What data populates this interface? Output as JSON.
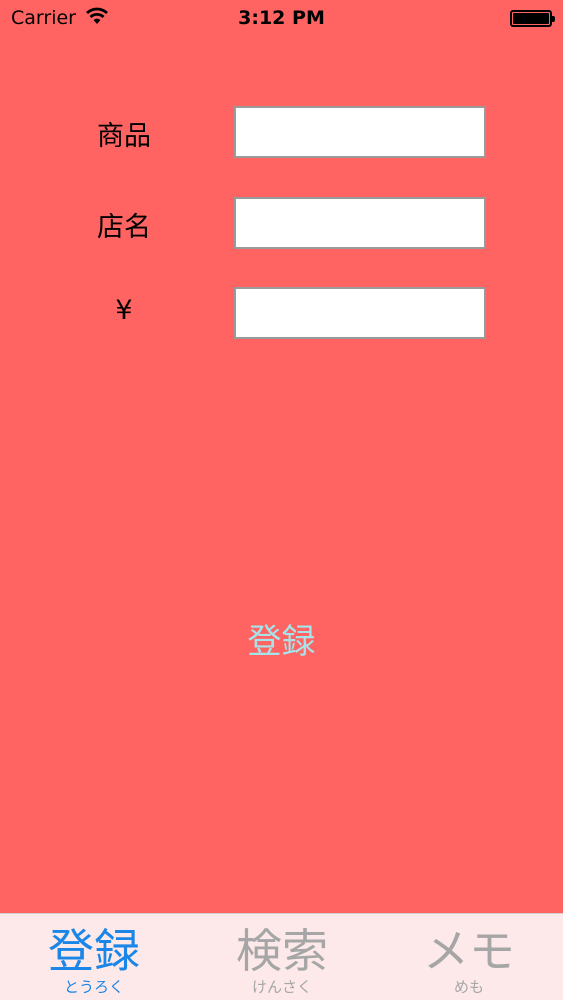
{
  "status_bar": {
    "carrier": "Carrier",
    "time": "3:12 PM"
  },
  "form": {
    "product_label": "商品",
    "product_value": "",
    "shop_label": "店名",
    "shop_value": "",
    "price_label": "¥",
    "price_value": ""
  },
  "register_button": {
    "label": "登録"
  },
  "tab_bar": {
    "items": [
      {
        "title": "登録",
        "subtitle": "とうろく",
        "active": true
      },
      {
        "title": "検索",
        "subtitle": "けんさく",
        "active": false
      },
      {
        "title": "メモ",
        "subtitle": "めも",
        "active": false
      }
    ]
  },
  "colors": {
    "background": "#ff6462",
    "accent": "#1a86e8",
    "button_text": "#a7e3ea",
    "tab_bar_bg": "#fde9ea",
    "inactive_tab": "#a6a6a6"
  }
}
